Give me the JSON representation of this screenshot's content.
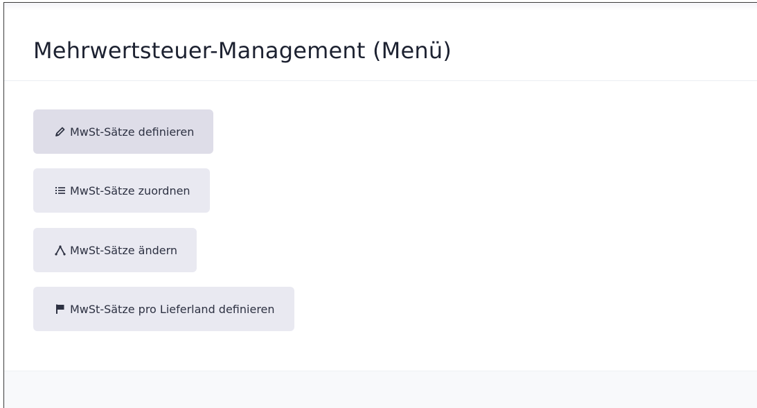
{
  "header": {
    "title": "Mehrwertsteuer-Management (Menü)"
  },
  "menu": {
    "items": [
      {
        "label": "MwSt-Sätze definieren",
        "icon": "pencil-icon"
      },
      {
        "label": "MwSt-Sätze zuordnen",
        "icon": "list-icon"
      },
      {
        "label": "MwSt-Sätze ändern",
        "icon": "change-icon"
      },
      {
        "label": "MwSt-Sätze pro Lieferland definieren",
        "icon": "flag-icon"
      }
    ]
  },
  "colors": {
    "button_bg": "#e9e9f1",
    "button_active_bg": "#dedde8",
    "title_text": "#1d2231",
    "button_text": "#2d3142"
  }
}
